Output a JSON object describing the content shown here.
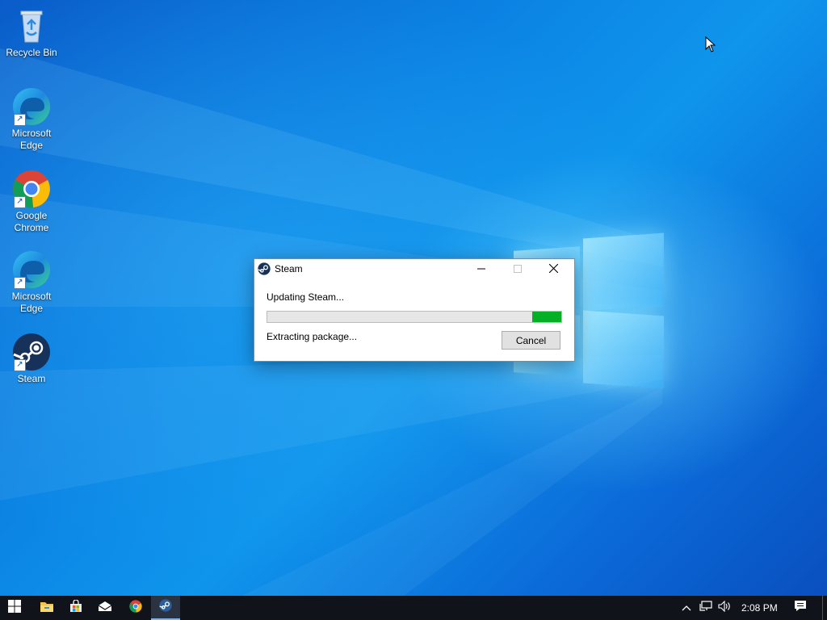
{
  "desktop": {
    "icons": [
      {
        "label": "Recycle Bin"
      },
      {
        "label": "Microsoft Edge"
      },
      {
        "label": "Google Chrome"
      },
      {
        "label": "Microsoft Edge"
      },
      {
        "label": "Steam"
      }
    ]
  },
  "dialog": {
    "title": "Steam",
    "status_primary": "Updating Steam...",
    "status_secondary": "Extracting package...",
    "cancel_label": "Cancel",
    "progress_percent": 10,
    "progress_color": "#06b025"
  },
  "taskbar": {
    "items": [
      "start-icon",
      "file-explorer-icon",
      "store-icon",
      "mail-icon",
      "chrome-icon",
      "steam-icon"
    ],
    "active_item": "steam-icon",
    "clock": "2:08 PM"
  },
  "colors": {
    "desktop_accent": "#0b82e3",
    "taskbar": "#101319"
  }
}
